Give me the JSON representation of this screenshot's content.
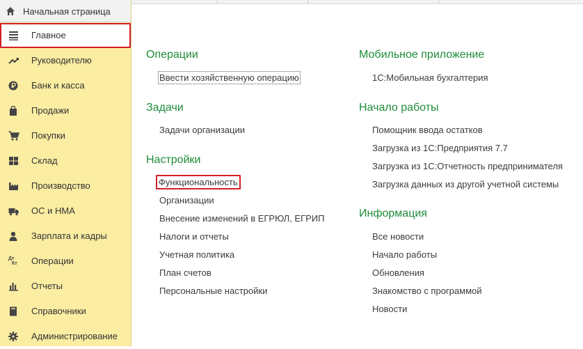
{
  "sidebar": {
    "home_label": "Начальная страница",
    "items": [
      {
        "label": "Главное",
        "icon": "menu-lines-icon",
        "selected": true
      },
      {
        "label": "Руководителю",
        "icon": "trend-up-icon"
      },
      {
        "label": "Банк и касса",
        "icon": "ruble-coin-icon"
      },
      {
        "label": "Продажи",
        "icon": "shopping-bag-icon"
      },
      {
        "label": "Покупки",
        "icon": "cart-icon"
      },
      {
        "label": "Склад",
        "icon": "warehouse-grid-icon"
      },
      {
        "label": "Производство",
        "icon": "factory-icon"
      },
      {
        "label": "ОС и НМА",
        "icon": "truck-icon"
      },
      {
        "label": "Зарплата и кадры",
        "icon": "person-icon"
      },
      {
        "label": "Операции",
        "icon": "debit-credit-icon",
        "icon_text_top": "Дт",
        "icon_text_bottom": "Кт"
      },
      {
        "label": "Отчеты",
        "icon": "bar-chart-icon"
      },
      {
        "label": "Справочники",
        "icon": "book-icon"
      },
      {
        "label": "Администрирование",
        "icon": "gear-icon"
      }
    ]
  },
  "main": {
    "left_column": [
      {
        "title": "Операции",
        "links": [
          "Ввести хозяйственную операцию"
        ]
      },
      {
        "title": "Задачи",
        "links": [
          "Задачи организации"
        ]
      },
      {
        "title": "Настройки",
        "links": [
          "Функциональность",
          "Организации",
          "Внесение изменений в ЕГРЮЛ, ЕГРИП",
          "Налоги и отчеты",
          "Учетная политика",
          "План счетов",
          "Персональные настройки"
        ]
      }
    ],
    "right_column": [
      {
        "title": "Мобильное приложение",
        "links": [
          "1С:Мобильная бухгалтерия"
        ]
      },
      {
        "title": "Начало работы",
        "links": [
          "Помощник ввода остатков",
          "Загрузка из 1С:Предприятия 7.7",
          "Загрузка из 1С:Отчетность предпринимателя",
          "Загрузка данных из другой учетной системы"
        ]
      },
      {
        "title": "Информация",
        "links": [
          "Все новости",
          "Начало работы",
          "Обновления",
          "Знакомство с программой",
          "Новости"
        ]
      }
    ]
  },
  "colors": {
    "sidebar_bg": "#fbeda2",
    "section_title": "#1e8c3a",
    "highlight_border": "#d21f26"
  }
}
